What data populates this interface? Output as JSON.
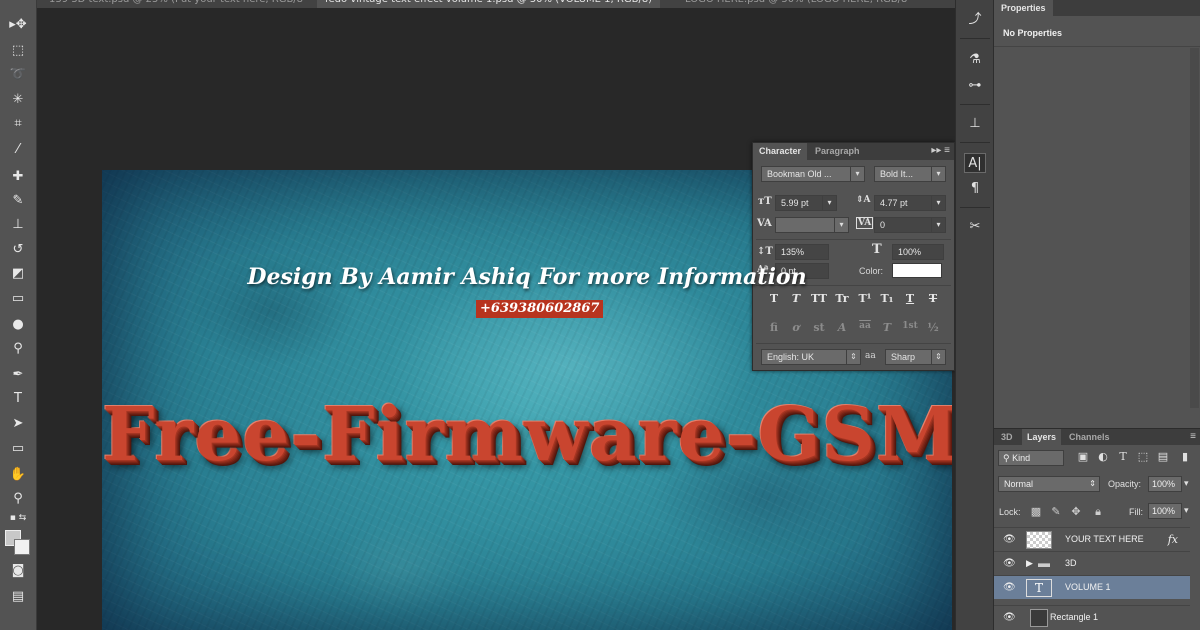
{
  "tabs": [
    "139 3D text.psd @ 25% (Put your text here, RGB/8",
    "fedo vintage text effect volume 1.psd @ 50% (VOLUME 1, RGB/8)",
    "LOGO HERE.psd @ 50% (LOGO HERE, RGB/8"
  ],
  "canvas": {
    "credit_line": "Design By Aamir Ashiq For more Information",
    "phone": "+639380602867",
    "title": "Free-Firmware-GSM"
  },
  "toolbar_icons": [
    "move-icon",
    "marquee-icon",
    "lasso-icon",
    "magic-wand-icon",
    "crop-icon",
    "eyedropper-icon",
    "healing-brush-icon",
    "brush-icon",
    "clone-stamp-icon",
    "history-brush-icon",
    "eraser-icon",
    "gradient-icon",
    "blur-icon",
    "dodge-icon",
    "pen-icon",
    "type-icon",
    "path-selection-icon",
    "rectangle-icon",
    "hand-icon",
    "zoom-icon",
    "quick-mask-icon",
    "screen-mode-icon"
  ],
  "character": {
    "tab_character": "Character",
    "tab_paragraph": "Paragraph",
    "font_family": "Bookman Old ...",
    "font_style": "Bold It...",
    "font_size": "5.99 pt",
    "leading": "4.77 pt",
    "kerning": "",
    "tracking": "0",
    "vertical_scale": "135%",
    "horizontal_scale": "100%",
    "baseline_shift": "0 pt",
    "color_label": "Color:",
    "color": "#ffffff",
    "style_buttons": [
      "T",
      "T",
      "TT",
      "Tr",
      "T¹",
      "T₁",
      "T",
      "T"
    ],
    "opentype_buttons": [
      "fi",
      "ơ",
      "st",
      "A",
      "aa",
      "T",
      "1st",
      "½"
    ],
    "language": "English: UK",
    "aa_icon": "aa",
    "antialias": "Sharp"
  },
  "properties": {
    "tab": "Properties",
    "message": "No Properties"
  },
  "layers_panel": {
    "tabs": [
      "3D",
      "Layers",
      "Channels"
    ],
    "kind": "Kind",
    "blend_mode": "Normal",
    "opacity_label": "Opacity:",
    "opacity": "100%",
    "lock_label": "Lock:",
    "fill_label": "Fill:",
    "fill": "100%",
    "layers": [
      {
        "name": "YOUR TEXT HERE",
        "fx": "fx"
      },
      {
        "name": "3D"
      },
      {
        "name": "VOLUME 1"
      },
      {
        "name": "Rectangle 1"
      }
    ]
  }
}
